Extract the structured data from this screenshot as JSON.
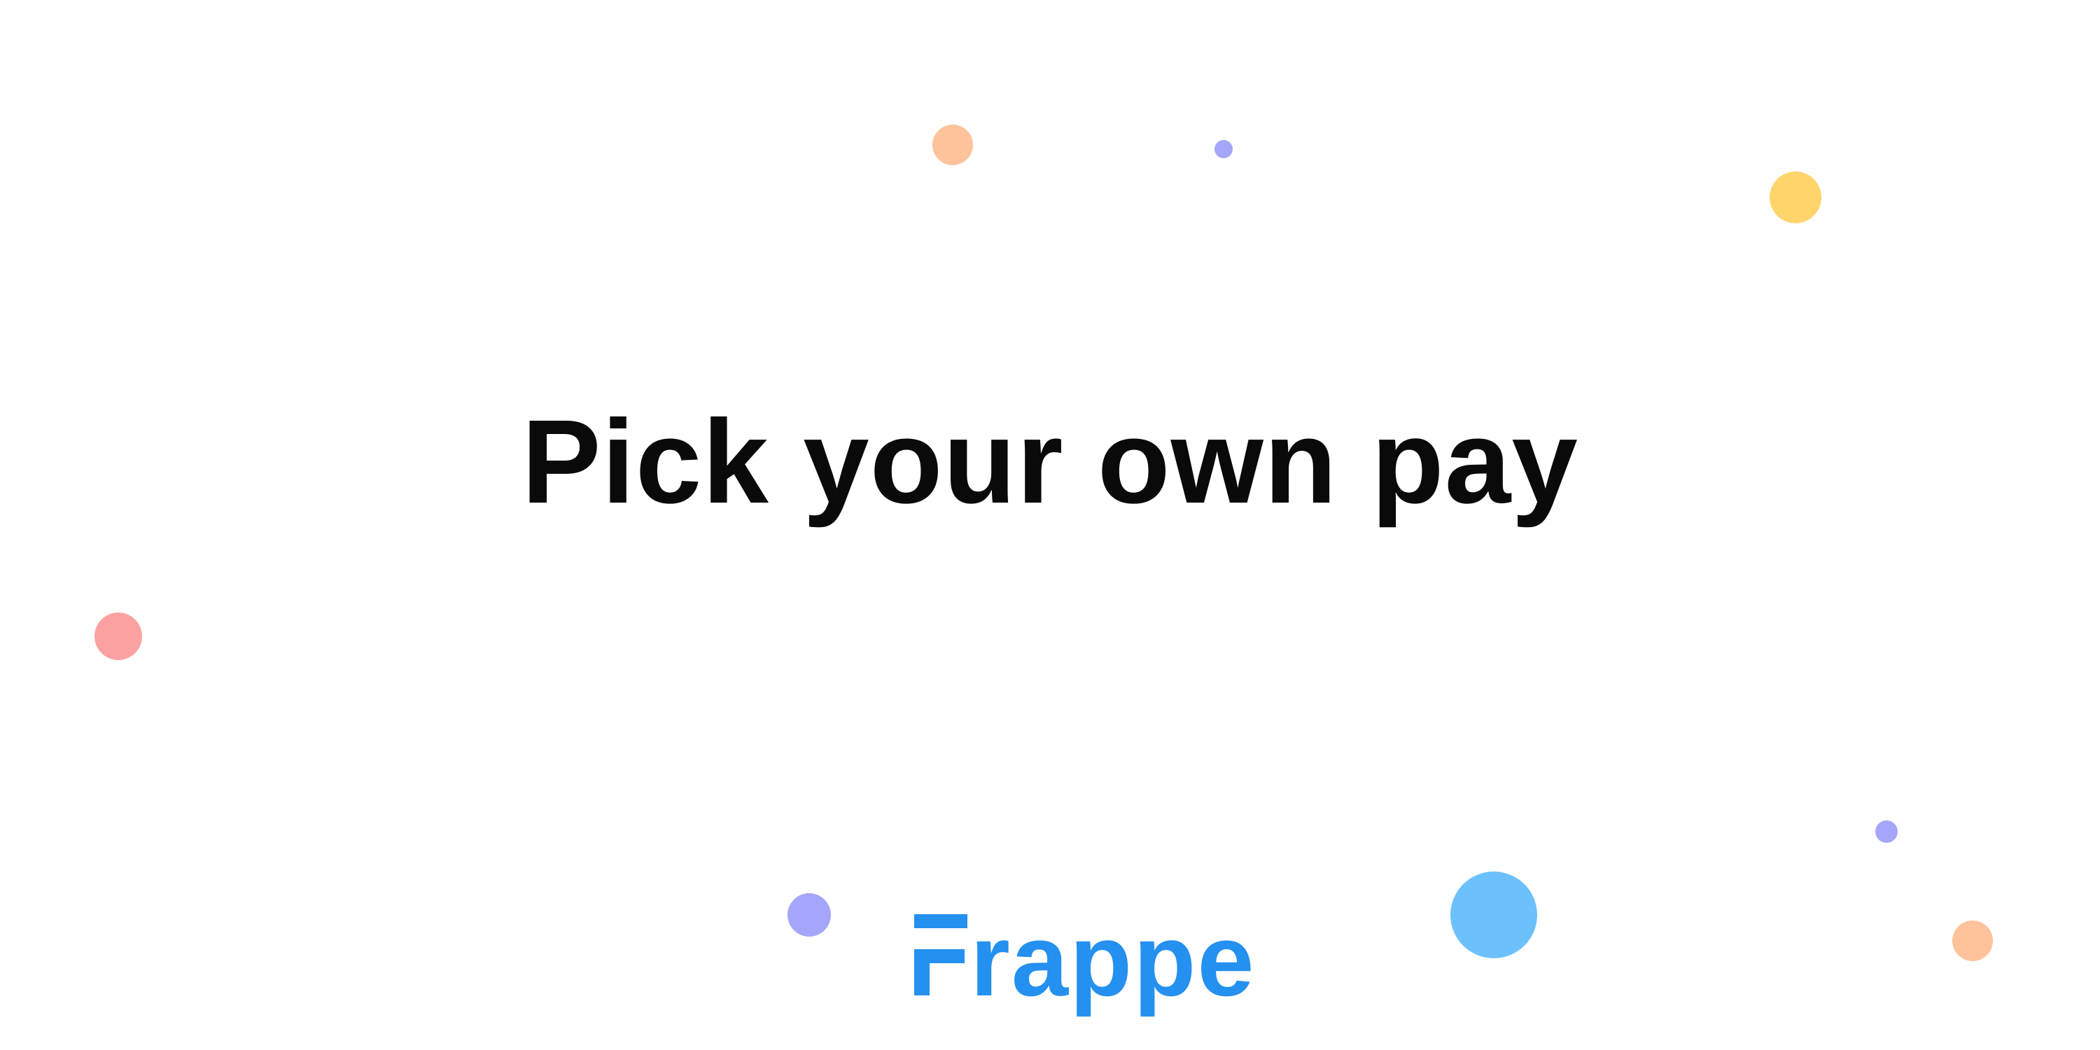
{
  "headline": "Pick your own pay",
  "brand": {
    "name": "Frappe",
    "color": "#2490EF"
  },
  "decorations": {
    "colors": {
      "peach": "#FEC39A",
      "lavender": "#A5A5FA",
      "yellow": "#FFD46B",
      "coral": "#FBA1A1",
      "sky": "#6CC1FD"
    }
  }
}
